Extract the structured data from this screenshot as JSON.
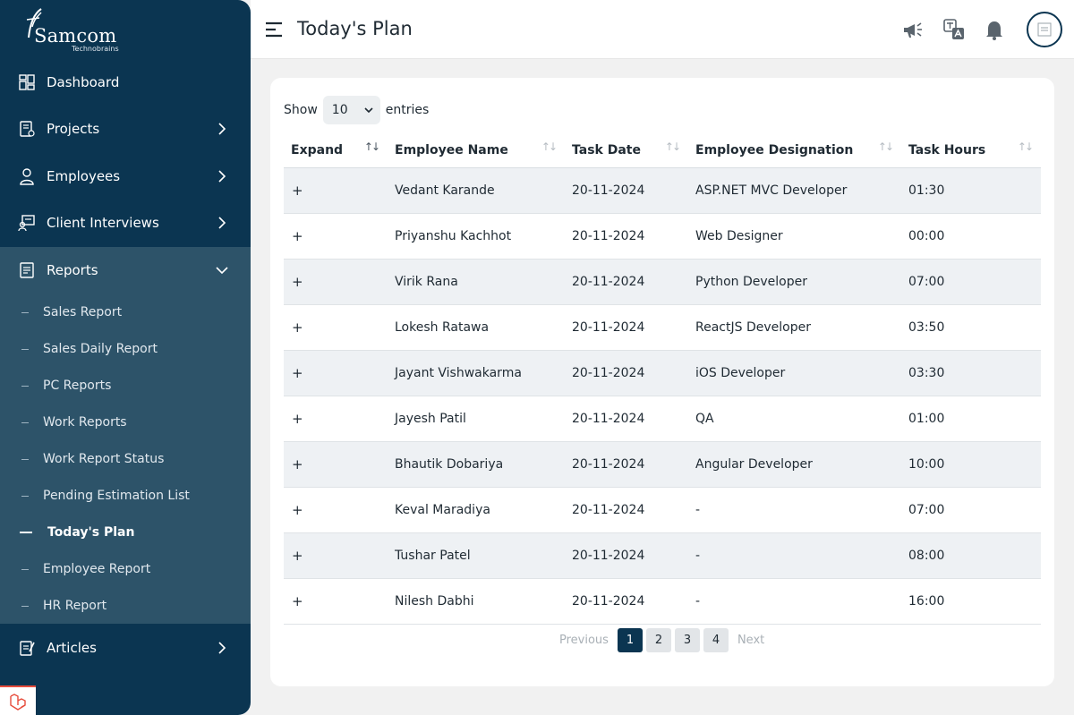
{
  "brand": {
    "name": "Samcom",
    "tagline": "Technobrains"
  },
  "header": {
    "title": "Today's Plan"
  },
  "sidebar": {
    "items": [
      {
        "label": "Dashboard",
        "icon": "dashboard-icon"
      },
      {
        "label": "Projects",
        "icon": "projects-icon"
      },
      {
        "label": "Employees",
        "icon": "user-icon"
      },
      {
        "label": "Client Interviews",
        "icon": "interview-icon"
      },
      {
        "label": "Reports",
        "icon": "report-icon"
      },
      {
        "label": "Articles",
        "icon": "article-icon"
      }
    ],
    "reports_sub": [
      {
        "label": "Sales Report"
      },
      {
        "label": "Sales Daily Report"
      },
      {
        "label": "PC Reports"
      },
      {
        "label": "Work Reports"
      },
      {
        "label": "Work Report Status"
      },
      {
        "label": "Pending Estimation List"
      },
      {
        "label": "Today's Plan"
      },
      {
        "label": "Employee Report"
      },
      {
        "label": "HR Report"
      }
    ]
  },
  "table_controls": {
    "show_label": "Show",
    "entries_value": "10",
    "entries_label": "entries"
  },
  "table": {
    "columns": [
      "Expand",
      "Employee Name",
      "Task Date",
      "Employee Designation",
      "Task Hours"
    ],
    "rows": [
      {
        "expand": "+",
        "name": "Vedant Karande",
        "date": "20-11-2024",
        "designation": "ASP.NET MVC Developer",
        "hours": "01:30"
      },
      {
        "expand": "+",
        "name": "Priyanshu Kachhot",
        "date": "20-11-2024",
        "designation": "Web Designer",
        "hours": "00:00"
      },
      {
        "expand": "+",
        "name": "Virik Rana",
        "date": "20-11-2024",
        "designation": "Python Developer",
        "hours": "07:00"
      },
      {
        "expand": "+",
        "name": "Lokesh Ratawa",
        "date": "20-11-2024",
        "designation": "ReactJS Developer",
        "hours": "03:50"
      },
      {
        "expand": "+",
        "name": "Jayant Vishwakarma",
        "date": "20-11-2024",
        "designation": "iOS Developer",
        "hours": "03:30"
      },
      {
        "expand": "+",
        "name": "Jayesh Patil",
        "date": "20-11-2024",
        "designation": "QA",
        "hours": "01:00"
      },
      {
        "expand": "+",
        "name": "Bhautik Dobariya",
        "date": "20-11-2024",
        "designation": "Angular Developer",
        "hours": "10:00"
      },
      {
        "expand": "+",
        "name": "Keval Maradiya",
        "date": "20-11-2024",
        "designation": "-",
        "hours": "07:00"
      },
      {
        "expand": "+",
        "name": "Tushar Patel",
        "date": "20-11-2024",
        "designation": "-",
        "hours": "08:00"
      },
      {
        "expand": "+",
        "name": "Nilesh Dabhi",
        "date": "20-11-2024",
        "designation": "-",
        "hours": "16:00"
      }
    ]
  },
  "pagination": {
    "previous": "Previous",
    "next": "Next",
    "pages": [
      "1",
      "2",
      "3",
      "4"
    ],
    "active": "1"
  },
  "colors": {
    "sidebar": "#0b3551",
    "sidebar_group": "#2d5369",
    "accent": "#0b3551"
  }
}
